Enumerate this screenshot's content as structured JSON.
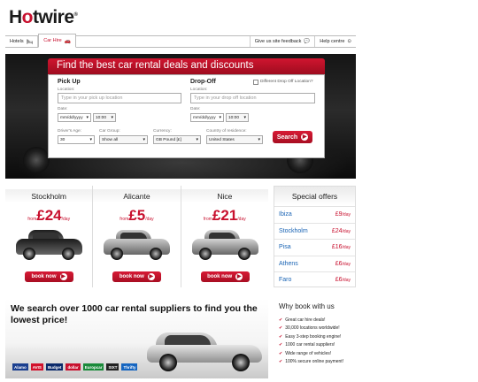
{
  "brand": {
    "logo_pre": "H",
    "logo_o": "o",
    "logo_post": "twire"
  },
  "nav": {
    "hotels": "Hotels",
    "car_hire": "Car Hire",
    "feedback": "Give us site feedback",
    "help": "Help centre"
  },
  "hero": {
    "title": "Find the best car rental deals and discounts",
    "pickup": {
      "heading": "Pick Up",
      "location_label": "Location:",
      "location_placeholder": "Type in your pick up location",
      "date_label": "Date:",
      "date_placeholder": "mm/dd/yyyy",
      "time": "10:00"
    },
    "dropoff": {
      "heading": "Drop-Off",
      "location_label": "Location:",
      "location_placeholder": "Type in your drop off location",
      "date_label": "Date:",
      "date_placeholder": "mm/dd/yyyy",
      "time": "10:00",
      "different_label": "Different Drop Off Location?"
    },
    "driver_age_label": "Driver's Age:",
    "driver_age": "30",
    "car_group_label": "Car Group:",
    "car_group": "Show all",
    "currency_label": "Currency:",
    "currency": "GB Pound [£]",
    "country_label": "Country of residence:",
    "country": "United States",
    "search_label": "Search"
  },
  "deals": [
    {
      "city": "Stockholm",
      "from": "from",
      "price": "£24",
      "per": "/day",
      "book": "book now",
      "color": "#1c1c1c"
    },
    {
      "city": "Alicante",
      "from": "from",
      "price": "£5",
      "per": "/day",
      "book": "book now",
      "color": "#c9c9c9"
    },
    {
      "city": "Nice",
      "from": "from",
      "price": "£21",
      "per": "/day",
      "book": "book now",
      "color": "#d4d4d4"
    }
  ],
  "offers": {
    "heading": "Special offers",
    "items": [
      {
        "city": "Ibiza",
        "price": "£9",
        "per": "/day"
      },
      {
        "city": "Stockholm",
        "price": "£24",
        "per": "/day"
      },
      {
        "city": "Pisa",
        "price": "£16",
        "per": "/day"
      },
      {
        "city": "Athens",
        "price": "£6",
        "per": "/day"
      },
      {
        "city": "Faro",
        "price": "£6",
        "per": "/day"
      }
    ]
  },
  "promo": {
    "text": "We search over 1000 car rental suppliers to find you the lowest price!"
  },
  "supplier_logos": [
    {
      "name": "Alamo",
      "color": "#1b3f8f"
    },
    {
      "name": "AVIS",
      "color": "#d2112b"
    },
    {
      "name": "Budget",
      "color": "#0b2a6b"
    },
    {
      "name": "dollar",
      "color": "#c8102e"
    },
    {
      "name": "Europcar",
      "color": "#1a8a3a"
    },
    {
      "name": "SIXT",
      "color": "#222222"
    },
    {
      "name": "Thrifty",
      "color": "#1565c0"
    }
  ],
  "why": {
    "heading": "Why book with us",
    "items": [
      "Great car hire deals!",
      "30,000 locations worldwide!",
      "Easy 3-step booking engine!",
      "1000 car rental suppliers!",
      "Wide range of vehicles!",
      "100% secure online payment!"
    ]
  },
  "colors": {
    "accent": "#c8102e",
    "link": "#1a64b4"
  }
}
